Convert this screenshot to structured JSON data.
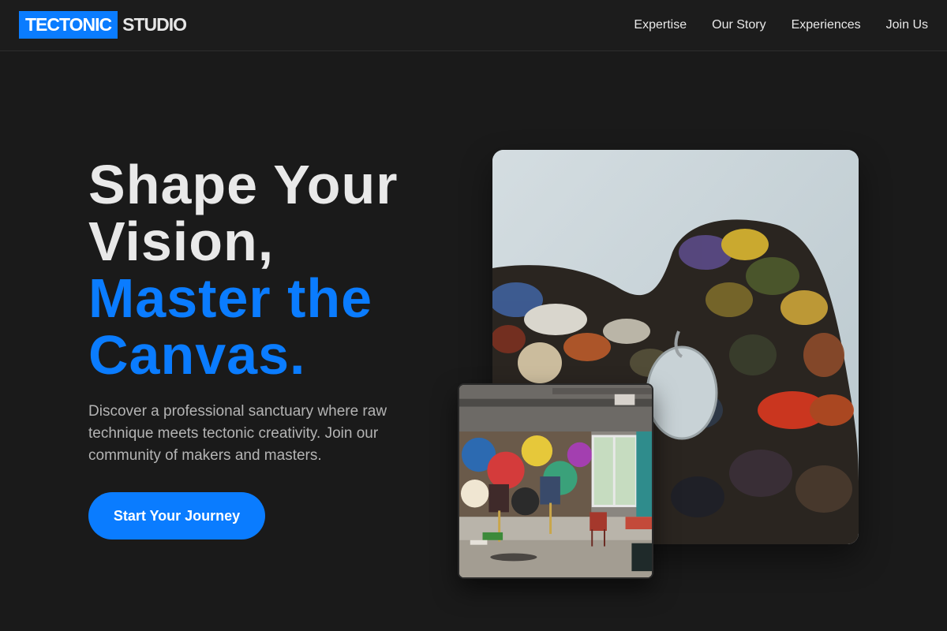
{
  "header": {
    "logo_mark": "TECTONIC",
    "logo_word": "STUDIO",
    "nav": [
      {
        "label": "Expertise"
      },
      {
        "label": "Our Story"
      },
      {
        "label": "Experiences"
      },
      {
        "label": "Join Us"
      }
    ]
  },
  "hero": {
    "title_line1": "Shape Your",
    "title_line2": "Vision,",
    "title_line3": "Master the",
    "title_line4": "Canvas.",
    "subtitle": "Discover a professional sanctuary where raw technique meets tectonic creativity. Join our community of makers and masters.",
    "cta_label": "Start Your Journey"
  },
  "colors": {
    "accent": "#0a7cff",
    "background": "#1a1a1a",
    "text": "#e9e9e9",
    "muted": "#b4b4b4"
  }
}
